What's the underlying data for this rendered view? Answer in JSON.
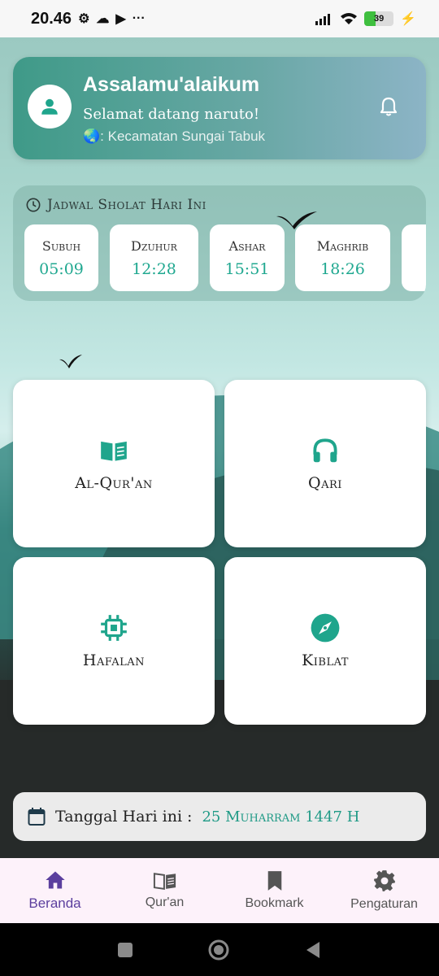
{
  "status": {
    "time": "20.46",
    "battery": "39"
  },
  "greeting": {
    "title": "Assalamu'alaikum",
    "welcome": "Selamat datang naruto!",
    "location": "🌏: Kecamatan Sungai Tabuk"
  },
  "sholat": {
    "title": "Jadwal Sholat Hari Ini",
    "times": [
      {
        "name": "Subuh",
        "time": "05:09"
      },
      {
        "name": "Dzuhur",
        "time": "12:28"
      },
      {
        "name": "Ashar",
        "time": "15:51"
      },
      {
        "name": "Maghrib",
        "time": "18:26"
      }
    ]
  },
  "menu": {
    "quran": "Al-Qur'an",
    "qari": "Qari",
    "hafalan": "Hafalan",
    "kiblat": "Kiblat"
  },
  "date": {
    "label": "Tanggal Hari ini :",
    "value": "25 Muharram 1447 H"
  },
  "nav": {
    "home": "Beranda",
    "quran": "Qur'an",
    "bookmark": "Bookmark",
    "settings": "Pengaturan"
  },
  "colors": {
    "accent": "#20a890",
    "nav_active": "#5b3f9e"
  }
}
